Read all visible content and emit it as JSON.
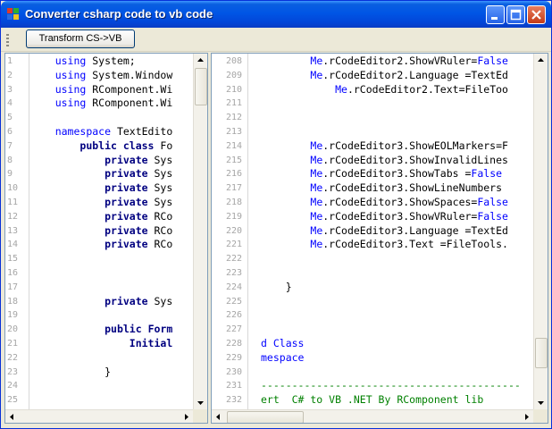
{
  "window": {
    "title": "Converter csharp code to vb code",
    "colors": {
      "titlebar": "#0055e5",
      "keyword": "#0000ff",
      "bold_keyword": "#000080",
      "comment": "#008000"
    }
  },
  "toolbar": {
    "transform_label": "Transform CS->VB"
  },
  "left_editor": {
    "line_numbers": [
      "1",
      "2",
      "3",
      "4",
      "5",
      "6",
      "7",
      "8",
      "9",
      "10",
      "11",
      "12",
      "13",
      "14",
      "15",
      "16",
      "17",
      "18",
      "19",
      "20",
      "21",
      "22",
      "23",
      "24",
      "25"
    ],
    "lines": [
      [
        {
          "t": "    "
        },
        {
          "t": "using",
          "c": "kw"
        },
        {
          "t": " System;"
        }
      ],
      [
        {
          "t": "    "
        },
        {
          "t": "using",
          "c": "kw"
        },
        {
          "t": " System.Window"
        }
      ],
      [
        {
          "t": "    "
        },
        {
          "t": "using",
          "c": "kw"
        },
        {
          "t": " RComponent.Wi"
        }
      ],
      [
        {
          "t": "    "
        },
        {
          "t": "using",
          "c": "kw"
        },
        {
          "t": " RComponent.Wi"
        }
      ],
      [
        {
          "t": ""
        }
      ],
      [
        {
          "t": "    "
        },
        {
          "t": "namespace",
          "c": "kw"
        },
        {
          "t": " TextEdito"
        }
      ],
      [
        {
          "t": "        "
        },
        {
          "t": "public class",
          "c": "kwb"
        },
        {
          "t": " Fo"
        }
      ],
      [
        {
          "t": "            "
        },
        {
          "t": "private",
          "c": "kwb"
        },
        {
          "t": " Sys"
        }
      ],
      [
        {
          "t": "            "
        },
        {
          "t": "private",
          "c": "kwb"
        },
        {
          "t": " Sys"
        }
      ],
      [
        {
          "t": "            "
        },
        {
          "t": "private",
          "c": "kwb"
        },
        {
          "t": " Sys"
        }
      ],
      [
        {
          "t": "            "
        },
        {
          "t": "private",
          "c": "kwb"
        },
        {
          "t": " Sys"
        }
      ],
      [
        {
          "t": "            "
        },
        {
          "t": "private",
          "c": "kwb"
        },
        {
          "t": " RCo"
        }
      ],
      [
        {
          "t": "            "
        },
        {
          "t": "private",
          "c": "kwb"
        },
        {
          "t": " RCo"
        }
      ],
      [
        {
          "t": "            "
        },
        {
          "t": "private",
          "c": "kwb"
        },
        {
          "t": " RCo"
        }
      ],
      [
        {
          "t": ""
        }
      ],
      [
        {
          "t": ""
        }
      ],
      [
        {
          "t": ""
        }
      ],
      [
        {
          "t": "            "
        },
        {
          "t": "private",
          "c": "kwb"
        },
        {
          "t": " Sys"
        }
      ],
      [
        {
          "t": ""
        }
      ],
      [
        {
          "t": "            "
        },
        {
          "t": "public",
          "c": "kwb"
        },
        {
          "t": " "
        },
        {
          "t": "Form",
          "c": "kwb"
        }
      ],
      [
        {
          "t": "                "
        },
        {
          "t": "Initial",
          "c": "kwb"
        }
      ],
      [
        {
          "t": ""
        }
      ],
      [
        {
          "t": "            }"
        }
      ],
      [
        {
          "t": ""
        }
      ],
      [
        {
          "t": ""
        }
      ]
    ]
  },
  "right_editor": {
    "line_numbers": [
      "208",
      "209",
      "210",
      "211",
      "212",
      "213",
      "214",
      "215",
      "216",
      "217",
      "218",
      "219",
      "220",
      "221",
      "222",
      "223",
      "224",
      "225",
      "226",
      "227",
      "228",
      "229",
      "230",
      "231",
      "232"
    ],
    "lines": [
      [
        {
          "t": "        "
        },
        {
          "t": "Me",
          "c": "kw"
        },
        {
          "t": ".rCodeEditor2.ShowVRuler="
        },
        {
          "t": "False",
          "c": "kw"
        }
      ],
      [
        {
          "t": "        "
        },
        {
          "t": "Me",
          "c": "kw"
        },
        {
          "t": ".rCodeEditor2.Language =TextEd"
        }
      ],
      [
        {
          "t": "            "
        },
        {
          "t": "Me",
          "c": "kw"
        },
        {
          "t": ".rCodeEditor2.Text=FileToo"
        }
      ],
      [
        {
          "t": ""
        }
      ],
      [
        {
          "t": ""
        }
      ],
      [
        {
          "t": ""
        }
      ],
      [
        {
          "t": "        "
        },
        {
          "t": "Me",
          "c": "kw"
        },
        {
          "t": ".rCodeEditor3.ShowEOLMarkers=F"
        }
      ],
      [
        {
          "t": "        "
        },
        {
          "t": "Me",
          "c": "kw"
        },
        {
          "t": ".rCodeEditor3.ShowInvalidLines"
        }
      ],
      [
        {
          "t": "        "
        },
        {
          "t": "Me",
          "c": "kw"
        },
        {
          "t": ".rCodeEditor3.ShowTabs ="
        },
        {
          "t": "False",
          "c": "kw"
        }
      ],
      [
        {
          "t": "        "
        },
        {
          "t": "Me",
          "c": "kw"
        },
        {
          "t": ".rCodeEditor3.ShowLineNumbers"
        }
      ],
      [
        {
          "t": "        "
        },
        {
          "t": "Me",
          "c": "kw"
        },
        {
          "t": ".rCodeEditor3.ShowSpaces="
        },
        {
          "t": "False",
          "c": "kw"
        }
      ],
      [
        {
          "t": "        "
        },
        {
          "t": "Me",
          "c": "kw"
        },
        {
          "t": ".rCodeEditor3.ShowVRuler="
        },
        {
          "t": "False",
          "c": "kw"
        }
      ],
      [
        {
          "t": "        "
        },
        {
          "t": "Me",
          "c": "kw"
        },
        {
          "t": ".rCodeEditor3.Language =TextEd"
        }
      ],
      [
        {
          "t": "        "
        },
        {
          "t": "Me",
          "c": "kw"
        },
        {
          "t": ".rCodeEditor3.Text =FileTools."
        }
      ],
      [
        {
          "t": ""
        }
      ],
      [
        {
          "t": ""
        }
      ],
      [
        {
          "t": "    }"
        }
      ],
      [
        {
          "t": ""
        }
      ],
      [
        {
          "t": ""
        }
      ],
      [
        {
          "t": ""
        }
      ],
      [
        {
          "t": "d Class",
          "c": "kw"
        }
      ],
      [
        {
          "t": "mespace",
          "c": "kw"
        }
      ],
      [
        {
          "t": ""
        }
      ],
      [
        {
          "t": "------------------------------------------",
          "c": "cm"
        }
      ],
      [
        {
          "t": "ert  C# to VB .NET By RComponent lib",
          "c": "cm"
        }
      ]
    ]
  }
}
